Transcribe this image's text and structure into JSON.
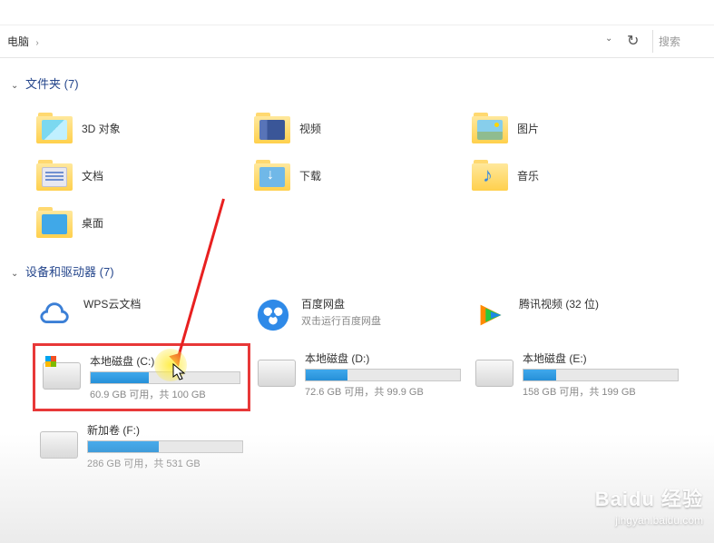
{
  "topbar_text": "",
  "breadcrumb": {
    "location": "电脑",
    "separator": "›"
  },
  "search": {
    "placeholder": "搜索"
  },
  "sections": {
    "folders": {
      "title": "文件夹",
      "count": "(7)"
    },
    "devices": {
      "title": "设备和驱动器",
      "count": "(7)"
    }
  },
  "folders": [
    {
      "label": "3D 对象"
    },
    {
      "label": "视频"
    },
    {
      "label": "图片"
    },
    {
      "label": "文档"
    },
    {
      "label": "下载"
    },
    {
      "label": "音乐"
    },
    {
      "label": "桌面"
    }
  ],
  "devices": [
    {
      "label": "WPS云文档",
      "sub": ""
    },
    {
      "label": "百度网盘",
      "sub": "双击运行百度网盘"
    },
    {
      "label": "腾讯视频 (32 位)",
      "sub": ""
    }
  ],
  "drives": [
    {
      "label": "本地磁盘 (C:)",
      "free": "60.9 GB 可用，共 100 GB",
      "fill_pct": 39
    },
    {
      "label": "本地磁盘 (D:)",
      "free": "72.6 GB 可用，共 99.9 GB",
      "fill_pct": 27
    },
    {
      "label": "本地磁盘 (E:)",
      "free": "158 GB 可用，共 199 GB",
      "fill_pct": 21
    },
    {
      "label": "新加卷 (F:)",
      "free": "286 GB 可用，共 531 GB",
      "fill_pct": 46
    }
  ],
  "watermark": {
    "main": "Baidu 经验",
    "sub": "jingyan.baidu.com"
  }
}
